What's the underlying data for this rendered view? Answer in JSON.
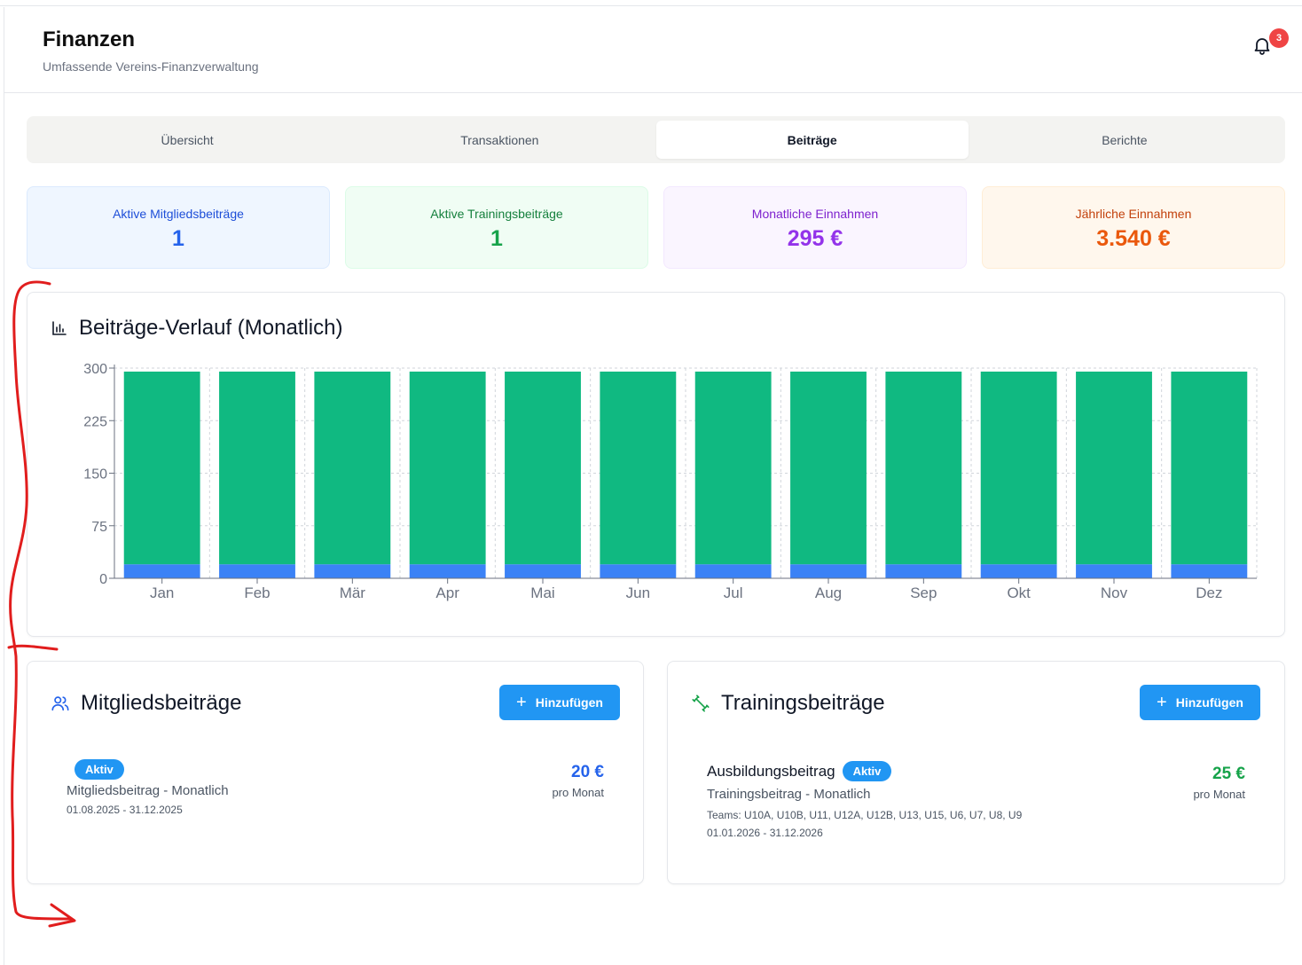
{
  "header": {
    "title": "Finanzen",
    "subtitle": "Umfassende Vereins-Finanzverwaltung",
    "notification_count": "3"
  },
  "tabs": [
    {
      "label": "Übersicht",
      "active": false
    },
    {
      "label": "Transaktionen",
      "active": false
    },
    {
      "label": "Beiträge",
      "active": true
    },
    {
      "label": "Berichte",
      "active": false
    }
  ],
  "stats": [
    {
      "label": "Aktive Mitgliedsbeiträge",
      "value": "1"
    },
    {
      "label": "Aktive Trainingsbeiträge",
      "value": "1"
    },
    {
      "label": "Monatliche Einnahmen",
      "value": "295 €"
    },
    {
      "label": "Jährliche Einnahmen",
      "value": "3.540 €"
    }
  ],
  "chart_card": {
    "title": "Beiträge-Verlauf (Monatlich)"
  },
  "chart_data": {
    "type": "bar",
    "stacked": true,
    "categories": [
      "Jan",
      "Feb",
      "Mär",
      "Apr",
      "Mai",
      "Jun",
      "Jul",
      "Aug",
      "Sep",
      "Okt",
      "Nov",
      "Dez"
    ],
    "series": [
      {
        "values": [
          20,
          20,
          20,
          20,
          20,
          20,
          20,
          20,
          20,
          20,
          20,
          20
        ],
        "color": "#3b82f6"
      },
      {
        "values": [
          275,
          275,
          275,
          275,
          275,
          275,
          275,
          275,
          275,
          275,
          275,
          275
        ],
        "color": "#10b981"
      }
    ],
    "yticks": [
      "0",
      "75",
      "150",
      "225",
      "300"
    ],
    "ylim": [
      0,
      300
    ],
    "grid": true
  },
  "member_fees": {
    "title": "Mitgliedsbeiträge",
    "add_label": "Hinzufügen",
    "items": [
      {
        "badge": "Aktiv",
        "type": "Mitgliedsbeitrag - Monatlich",
        "dates": "01.08.2025 - 31.12.2025",
        "price": "20 €",
        "period": "pro Monat"
      }
    ]
  },
  "training_fees": {
    "title": "Trainingsbeiträge",
    "add_label": "Hinzufügen",
    "items": [
      {
        "name": "Ausbildungsbeitrag",
        "badge": "Aktiv",
        "type": "Trainingsbeitrag - Monatlich",
        "teams": "Teams: U10A, U10B, U11, U12A, U12B, U13, U15, U6, U7, U8, U9",
        "dates": "01.01.2026 - 31.12.2026",
        "price": "25 €",
        "period": "pro Monat"
      }
    ]
  },
  "colors": {
    "accent": "#2196f3",
    "blue": "#2563eb",
    "green": "#16a34a",
    "purple": "#9333ea",
    "orange": "#ea580c",
    "annotation": "#e11d1d"
  }
}
